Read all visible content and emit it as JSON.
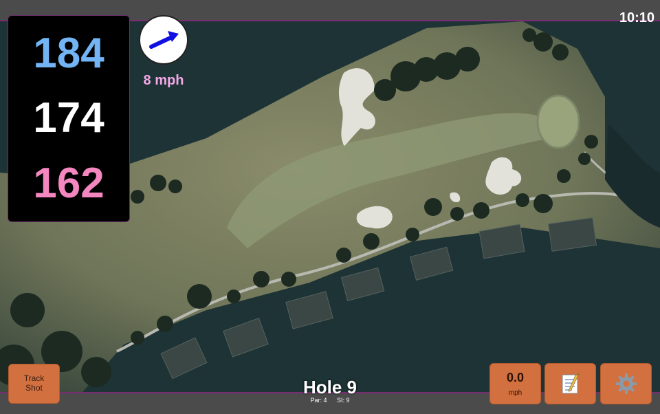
{
  "clock": "10:10",
  "distances": {
    "back": "184",
    "middle": "174",
    "front": "162"
  },
  "wind": {
    "speed": "8 mph",
    "arrow_icon": "wind-direction-arrow-icon",
    "arrow_color": "#1010e0"
  },
  "buttons": {
    "track_shot_line1": "Track",
    "track_shot_line2": "Shot",
    "speed_value": "0.0",
    "speed_unit": "mph",
    "notes_icon": "notepad-icon",
    "settings_icon": "gear-icon"
  },
  "hole": {
    "title": "Hole 9",
    "par": "Par: 4",
    "si": "SI: 9"
  },
  "colors": {
    "back_color": "#72b4f4",
    "middle_color": "#ffffff",
    "front_color": "#f486c0",
    "wind_text_color": "#f4a8e8",
    "button_color": "#d2703f",
    "accent_border": "#7a2c74"
  }
}
